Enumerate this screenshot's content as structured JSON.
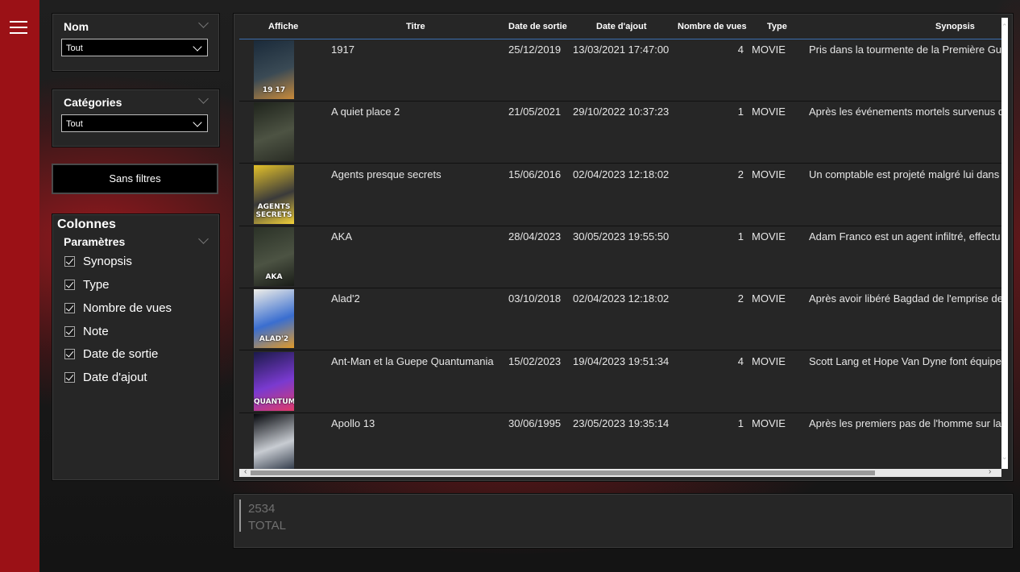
{
  "sidebar": {
    "menu_icon": "hamburger-menu-icon"
  },
  "filters": {
    "nom": {
      "title": "Nom",
      "value": "Tout"
    },
    "categories": {
      "title": "Catégories",
      "value": "Tout"
    },
    "reset_label": "Sans filtres"
  },
  "columns_panel": {
    "title": "Colonnes",
    "subtitle": "Paramètres",
    "options": [
      {
        "label": "Synopsis",
        "checked": true
      },
      {
        "label": "Type",
        "checked": true
      },
      {
        "label": "Nombre de vues",
        "checked": true
      },
      {
        "label": "Note",
        "checked": true
      },
      {
        "label": "Date de sortie",
        "checked": true
      },
      {
        "label": "Date d'ajout",
        "checked": true
      }
    ]
  },
  "table": {
    "headers": {
      "affiche": "Affiche",
      "titre": "Titre",
      "date_sortie": "Date de sortie",
      "date_ajout": "Date d'ajout",
      "vues": "Nombre de vues",
      "type": "Type",
      "synopsis": "Synopsis"
    },
    "rows": [
      {
        "titre": "1917",
        "date_sortie": "25/12/2019",
        "date_ajout": "13/03/2021 17:47:00",
        "vues": "4",
        "type": "MOVIE",
        "synopsis": "Pris dans la tourmente de la Première Gue",
        "poster_text": "19 17",
        "poster_colors": [
          "#1a2a3a",
          "#3a4a55",
          "#c98a3a"
        ]
      },
      {
        "titre": "A quiet place 2",
        "date_sortie": "21/05/2021",
        "date_ajout": "29/10/2022 10:37:23",
        "vues": "1",
        "type": "MOVIE",
        "synopsis": "Après les événements mortels survenus d",
        "poster_text": "",
        "poster_colors": [
          "#1f241c",
          "#4d5343",
          "#2a2d25"
        ]
      },
      {
        "titre": "Agents presque secrets",
        "date_sortie": "15/06/2016",
        "date_ajout": "02/04/2023 12:18:02",
        "vues": "2",
        "type": "MOVIE",
        "synopsis": "Un comptable est projeté malgré lui dans",
        "poster_text": "AGENTS SECRETS",
        "poster_colors": [
          "#e3c12a",
          "#3a3a3a",
          "#f2d23a"
        ]
      },
      {
        "titre": "AKA",
        "date_sortie": "28/04/2023",
        "date_ajout": "30/05/2023 19:55:50",
        "vues": "1",
        "type": "MOVIE",
        "synopsis": "Adam Franco est un agent infiltré, effectu",
        "poster_text": "AKA",
        "poster_colors": [
          "#2b3227",
          "#4c5343",
          "#1a1d18"
        ]
      },
      {
        "titre": "Alad'2",
        "date_sortie": "03/10/2018",
        "date_ajout": "02/04/2023 12:18:02",
        "vues": "2",
        "type": "MOVIE",
        "synopsis": "Après avoir libéré Bagdad de l'emprise de",
        "poster_text": "ALAD'2",
        "poster_colors": [
          "#f0efe8",
          "#3a6ed0",
          "#e09a2a"
        ]
      },
      {
        "titre": "Ant-Man et la Guepe Quantumania",
        "date_sortie": "15/02/2023",
        "date_ajout": "19/04/2023 19:51:34",
        "vues": "4",
        "type": "MOVIE",
        "synopsis": "Scott Lang et Hope Van Dyne font équipe",
        "poster_text": "QUANTUMANIA",
        "poster_colors": [
          "#1b1a4a",
          "#7a3ad0",
          "#e03a6a"
        ]
      },
      {
        "titre": "Apollo 13",
        "date_sortie": "30/06/1995",
        "date_ajout": "23/05/2023 19:35:14",
        "vues": "1",
        "type": "MOVIE",
        "synopsis": "Après les premiers pas de l'homme sur la",
        "poster_text": "",
        "poster_colors": [
          "#05070c",
          "#c8ccd2",
          "#202a3a"
        ]
      }
    ]
  },
  "total": {
    "value": "2534",
    "label": "TOTAL"
  }
}
